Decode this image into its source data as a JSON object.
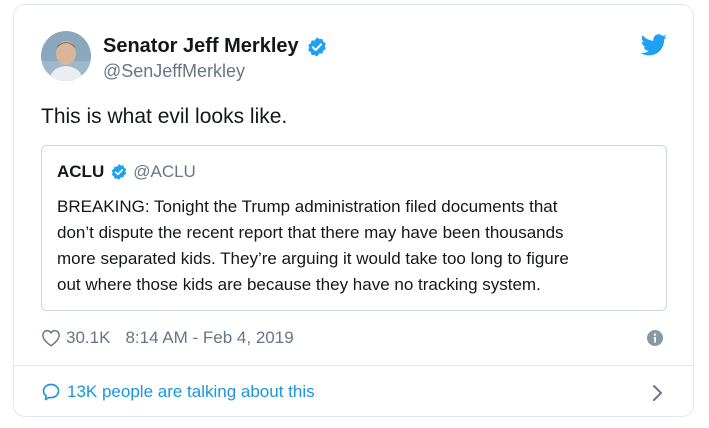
{
  "author": {
    "name": "Senator Jeff Merkley",
    "handle": "@SenJeffMerkley",
    "avatar_icon": "avatar-photo",
    "verified_icon": "verified-badge-icon"
  },
  "tweet": {
    "text": "This is what evil looks like."
  },
  "quoted_tweet": {
    "name": "ACLU",
    "handle": "@ACLU",
    "verified_icon": "verified-badge-icon",
    "lines": [
      "BREAKING: Tonight the Trump administration filed documents that",
      "don’t dispute the recent report that there may have been thousands",
      "more separated kids. They’re arguing it would take too long to figure",
      "out where those kids are because they have no tracking system."
    ]
  },
  "meta": {
    "likes": "30.1K",
    "timestamp": "8:14 AM - Feb 4, 2019",
    "heart_icon": "heart-icon",
    "info_icon": "info-icon"
  },
  "footer": {
    "talking_text": "13K people are talking about this",
    "bubble_icon": "speech-bubble-icon",
    "chevron_icon": "chevron-right-icon"
  },
  "colors": {
    "brand_blue": "#1da1f2",
    "link_blue": "#1b95e0",
    "muted_text": "#657786",
    "border": "#e1e8ed"
  }
}
